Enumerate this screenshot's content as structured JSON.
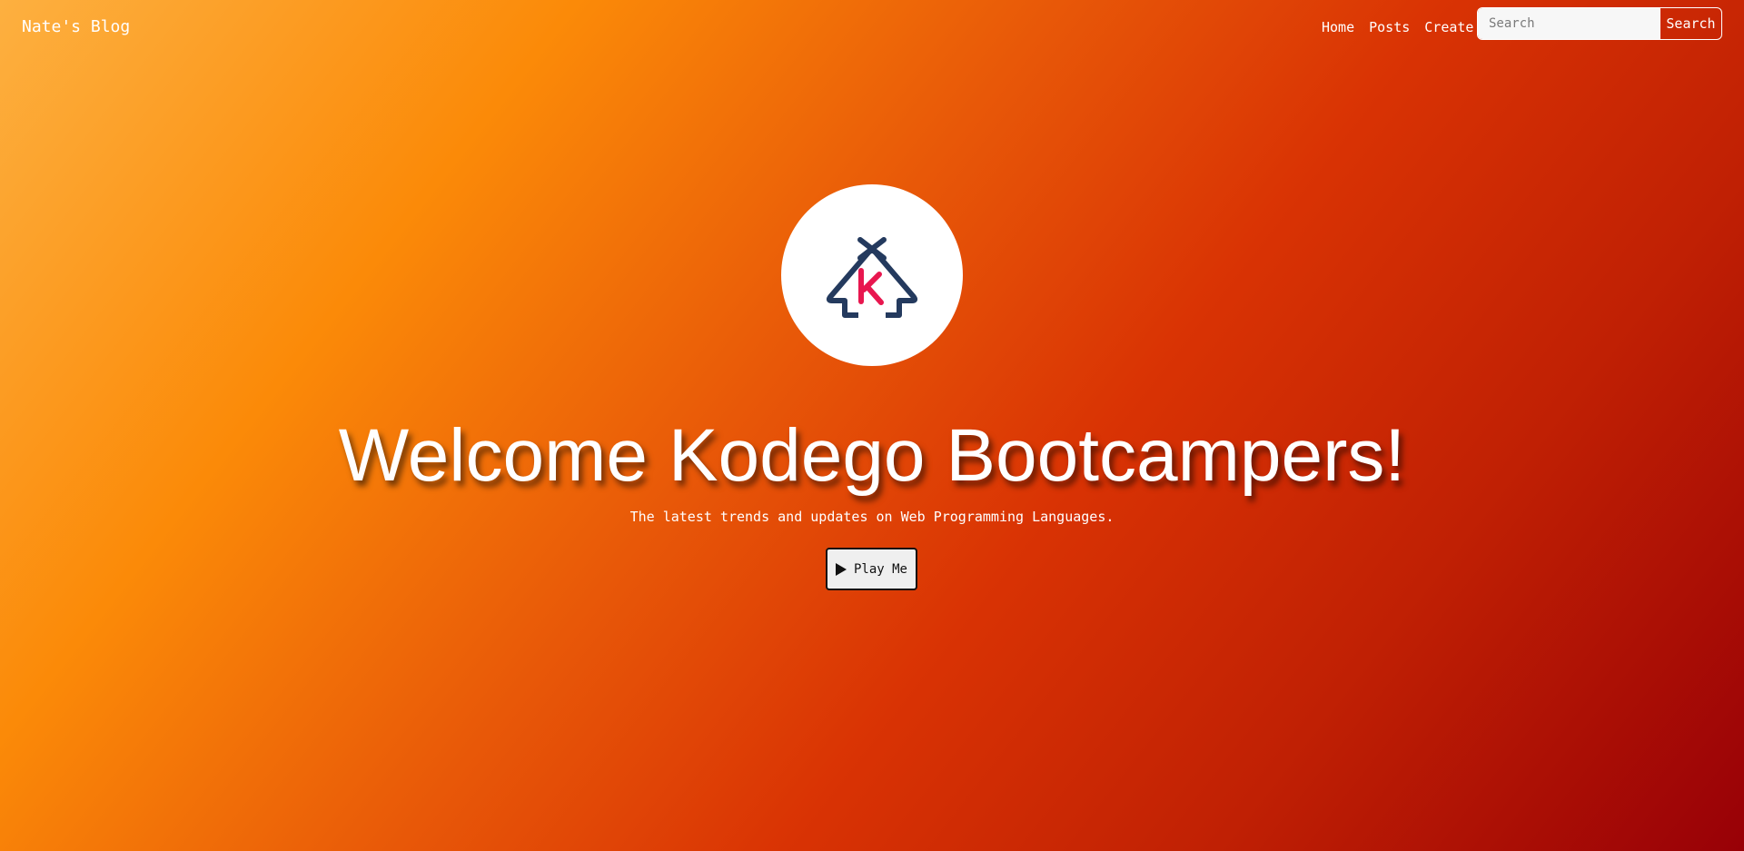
{
  "navbar": {
    "brand": "Nate's Blog",
    "links": [
      "Home",
      "Posts",
      "Create"
    ],
    "search": {
      "placeholder": "Search",
      "value": "",
      "button_label": "Search"
    }
  },
  "hero": {
    "logo": {
      "icon": "house-k-logo",
      "letter": "K",
      "colors": {
        "house": "#243a5e",
        "letter": "#e8174f"
      }
    },
    "title": "Welcome Kodego Bootcampers!",
    "subtitle": "The latest trends and updates on Web Programming Languages.",
    "play_button": {
      "label": "Play Me",
      "icon": "play-icon"
    }
  },
  "colors": {
    "gradient_start": "#fdb040",
    "gradient_mid": "#d93304",
    "gradient_end": "#980006",
    "text": "#ffffff"
  }
}
